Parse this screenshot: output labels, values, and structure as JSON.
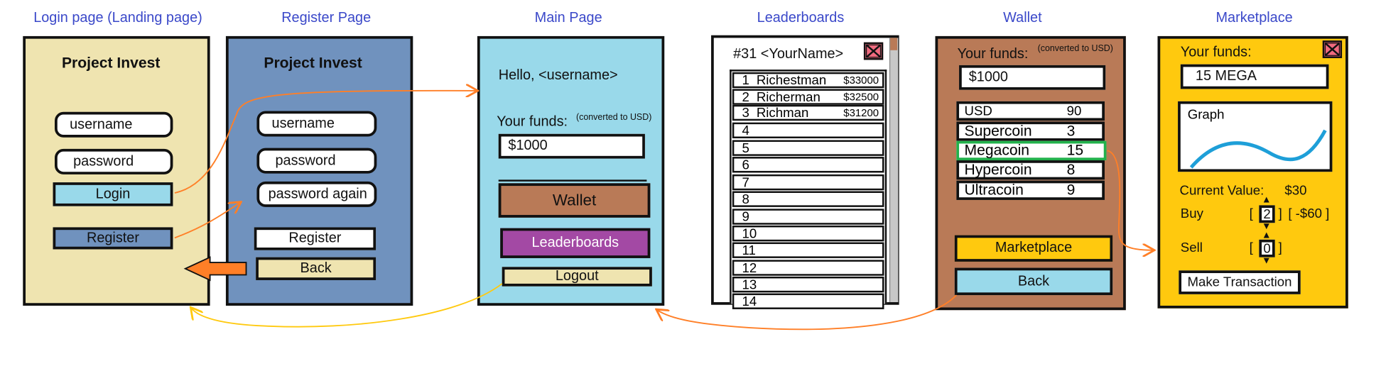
{
  "titles": {
    "login": "Login page (Landing page)",
    "register": "Register Page",
    "main": "Main Page",
    "leaderboards": "Leaderboards",
    "wallet": "Wallet",
    "marketplace": "Marketplace"
  },
  "login": {
    "app_name": "Project  Invest",
    "username": "username",
    "password": "password",
    "login_button": "Login",
    "register_button": "Register"
  },
  "register": {
    "app_name": "Project  Invest",
    "username": "username",
    "password": "password",
    "password_again": "password again",
    "register_button": "Register",
    "back_button": "Back"
  },
  "main": {
    "greeting": "Hello, <username>",
    "funds_label": "Your funds:",
    "funds_note": "(converted to USD)",
    "funds_value": "$1000",
    "wallet_button": "Wallet",
    "leaderboards_button": "Leaderboards",
    "logout_button": "Logout"
  },
  "leaderboards": {
    "own_rank": "#31 <YourName>",
    "rows": [
      {
        "rank": "1",
        "name": "Richestman",
        "money": "$33000"
      },
      {
        "rank": "2",
        "name": "Richerman",
        "money": "$32500"
      },
      {
        "rank": "3",
        "name": "Richman",
        "money": "$31200"
      },
      {
        "rank": "4",
        "name": "",
        "money": ""
      },
      {
        "rank": "5",
        "name": "",
        "money": ""
      },
      {
        "rank": "6",
        "name": "",
        "money": ""
      },
      {
        "rank": "7",
        "name": "",
        "money": ""
      },
      {
        "rank": "8",
        "name": "",
        "money": ""
      },
      {
        "rank": "9",
        "name": "",
        "money": ""
      },
      {
        "rank": "10",
        "name": "",
        "money": ""
      },
      {
        "rank": "11",
        "name": "",
        "money": ""
      },
      {
        "rank": "12",
        "name": "",
        "money": ""
      },
      {
        "rank": "13",
        "name": "",
        "money": ""
      },
      {
        "rank": "14",
        "name": "",
        "money": ""
      }
    ]
  },
  "wallet": {
    "funds_label": "Your funds:",
    "funds_note": "(converted to USD)",
    "funds_value": "$1000",
    "holdings": [
      {
        "currency": "USD",
        "amount": "90"
      },
      {
        "currency": "Supercoin",
        "amount": "3"
      },
      {
        "currency": "Megacoin",
        "amount": "15"
      },
      {
        "currency": "Hypercoin",
        "amount": "8"
      },
      {
        "currency": "Ultracoin",
        "amount": "9"
      }
    ],
    "marketplace_button": "Marketplace",
    "back_button": "Back"
  },
  "marketplace": {
    "funds_label": "Your funds:",
    "funds_value": "15 MEGA",
    "graph_label": "Graph",
    "current_value_label": "Current Value:",
    "current_value": "$30",
    "buy_label": "Buy",
    "buy_qty": "2",
    "buy_cost": "[ -$60 ]",
    "sell_label": "Sell",
    "sell_qty": "0",
    "bracket_open": "[",
    "bracket_close": "]",
    "transaction_button": "Make Transaction"
  },
  "colors": {
    "title_blue": "#3a48c9",
    "login_bg": "#efe4b0",
    "register_bg": "#7092be",
    "main_bg": "#99d9ea",
    "wallet_bg": "#b97a57",
    "marketplace_bg": "#ffc90e",
    "leaderboards_purple": "#a349a4",
    "arrow_orange": "#ff7f27",
    "arrow_gold": "#ffc90e",
    "highlight_green": "#22b14c",
    "graph_line": "#1e9fd8",
    "close_icon": "#ed1c24"
  },
  "icons": [
    "close-icon",
    "arrow-up-icon",
    "arrow-down-icon",
    "back-arrow-icon",
    "flow-arrow-icon"
  ]
}
